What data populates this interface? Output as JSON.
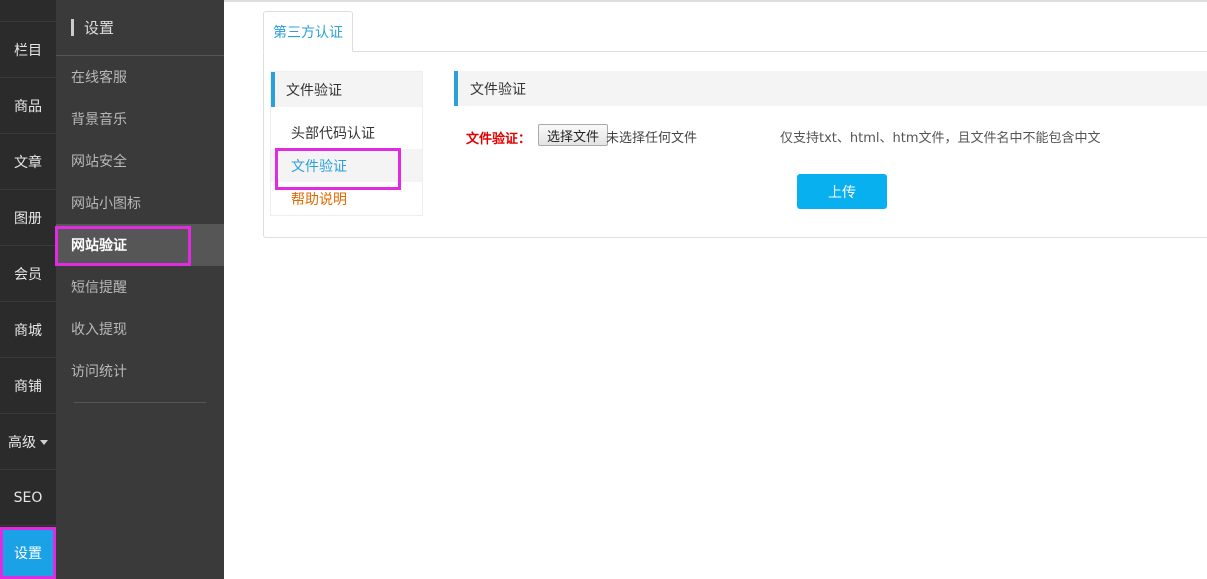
{
  "rail": {
    "items": [
      "栏目",
      "商品",
      "文章",
      "图册",
      "会员",
      "商城",
      "商铺",
      "高级",
      "SEO"
    ],
    "active": "设置"
  },
  "sidebar": {
    "title": "设置",
    "items": [
      "在线客服",
      "背景音乐",
      "网站安全",
      "网站小图标",
      "网站验证",
      "短信提醒",
      "收入提现",
      "访问统计"
    ]
  },
  "tabs": [
    "第三方认证"
  ],
  "subnav": {
    "header": "文件验证",
    "items": [
      "头部代码认证",
      "文件验证",
      "帮助说明"
    ]
  },
  "content": {
    "title": "文件验证",
    "label": "文件验证：",
    "choose_button": "选择文件",
    "file_status": "未选择任何文件",
    "hint": "仅支持txt、html、htm文件，且文件名中不能包含中文",
    "upload_button": "上传"
  },
  "colors": {
    "accent": "#2aa0da",
    "upload": "#08b0ef",
    "highlight": "#e02be0",
    "label_red": "#e00000",
    "help_orange": "#e06a00"
  }
}
